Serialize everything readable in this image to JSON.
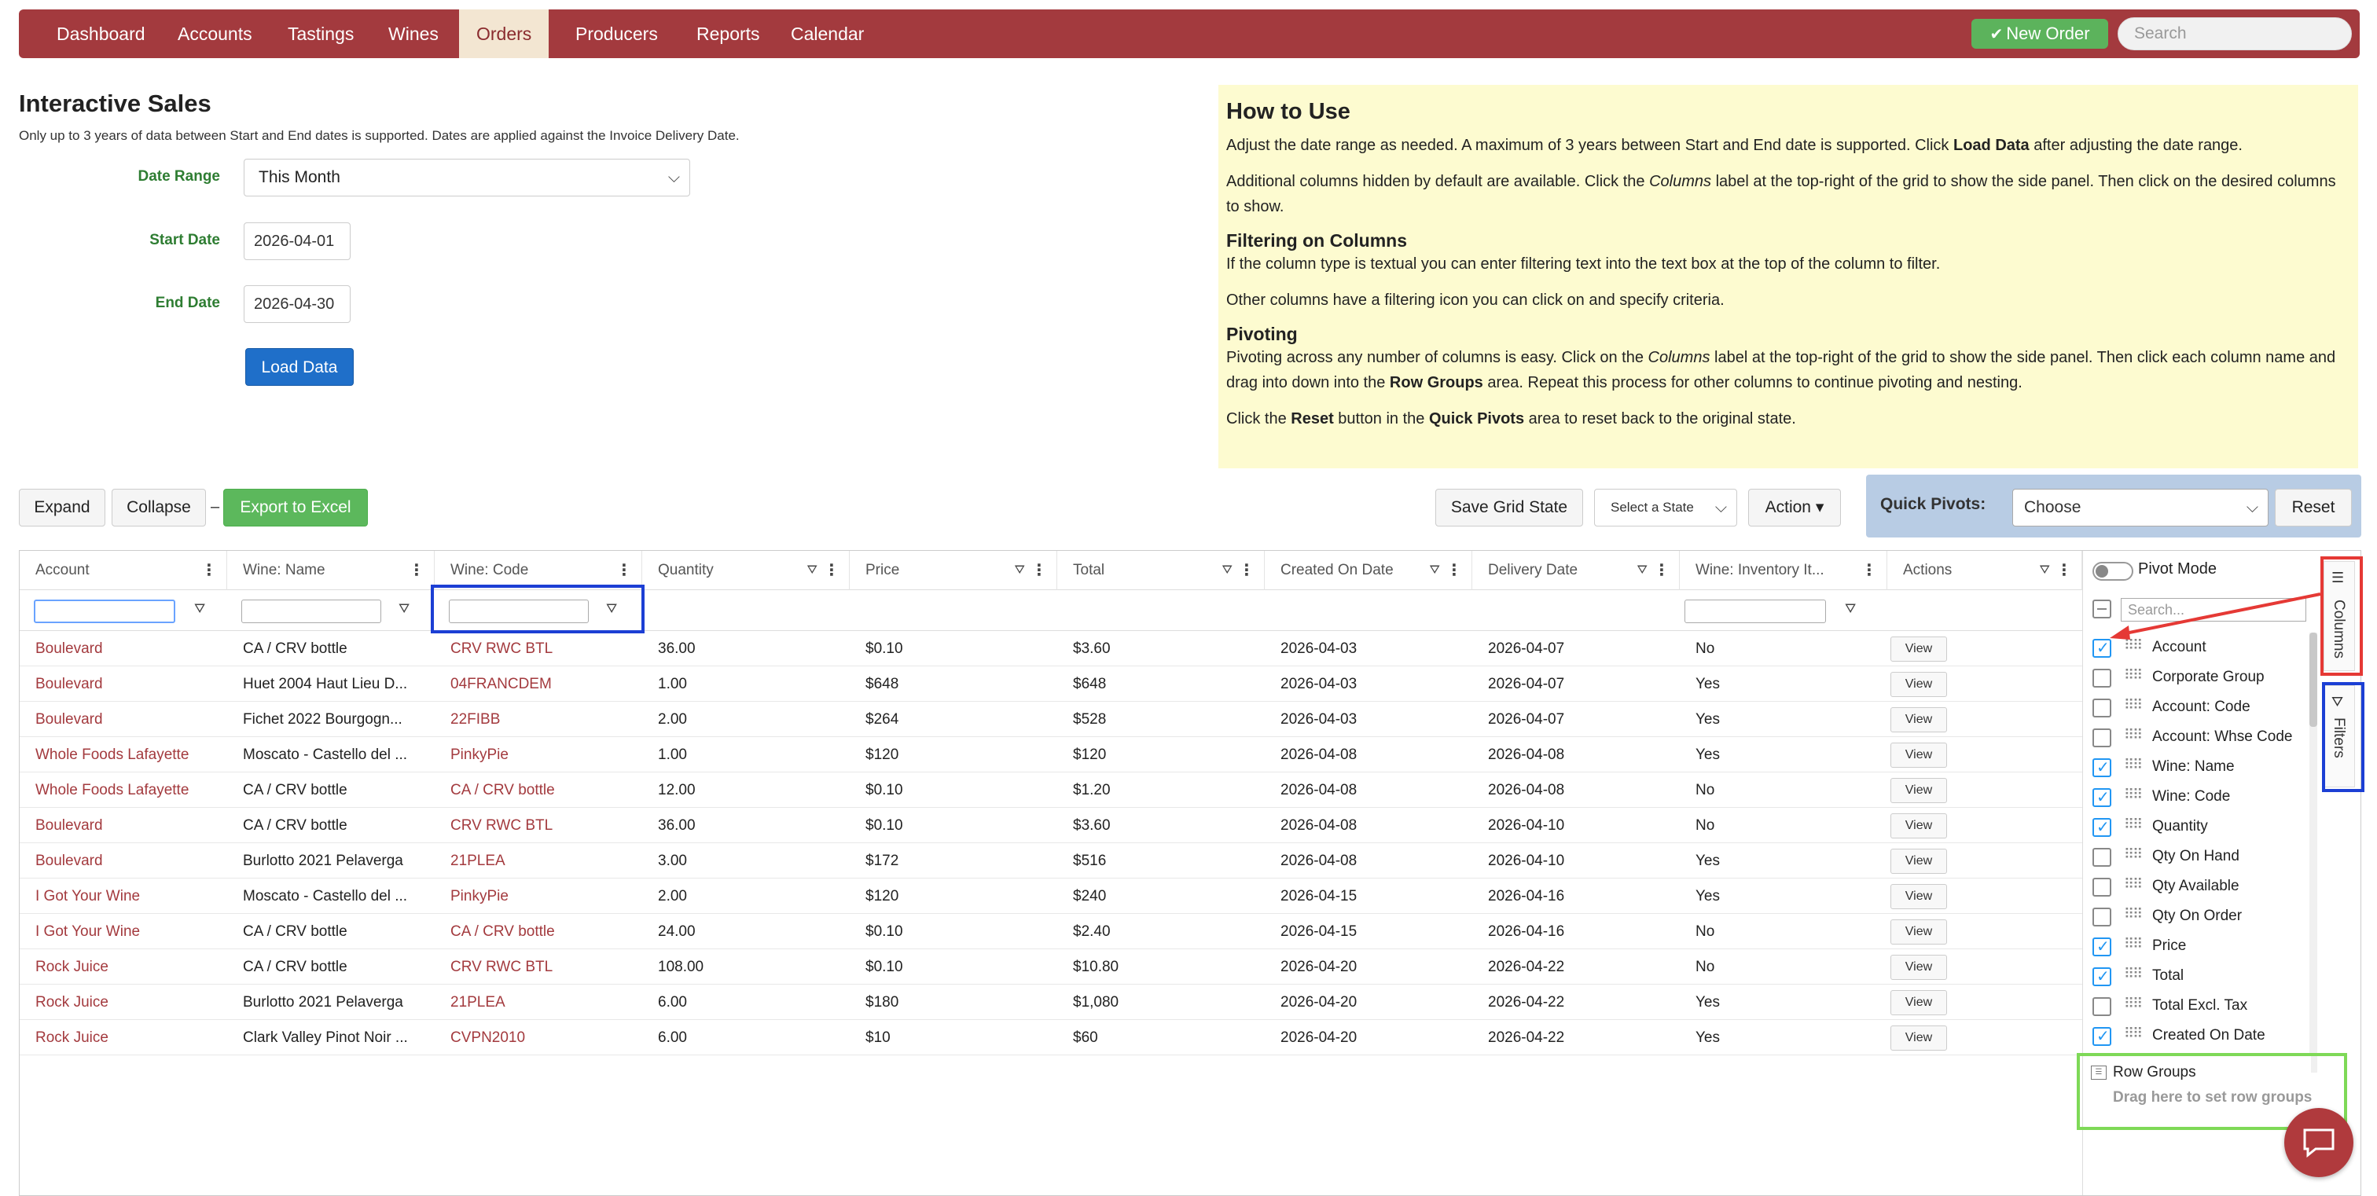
{
  "nav": {
    "items": [
      "Dashboard",
      "Accounts",
      "Tastings",
      "Wines",
      "Orders",
      "Producers",
      "Reports",
      "Calendar"
    ],
    "active": "Orders",
    "new_order": "New Order",
    "search_placeholder": "Search"
  },
  "page": {
    "title": "Interactive Sales",
    "subtitle": "Only up to 3 years of data between Start and End dates is supported. Dates are applied against the Invoice Delivery Date."
  },
  "form": {
    "date_range_label": "Date Range",
    "date_range_value": "This Month",
    "start_label": "Start Date",
    "start_value": "2026-04-01",
    "end_label": "End Date",
    "end_value": "2026-04-30",
    "load_button": "Load Data"
  },
  "help": {
    "title": "How to Use",
    "p1_a": "Adjust the date range as needed. A maximum of 3 years between Start and End date is supported. Click ",
    "p1_b": "Load Data",
    "p1_c": " after adjusting the date range.",
    "p2_a": "Additional columns hidden by default are available. Click the ",
    "p2_b": "Columns",
    "p2_c": " label at the top-right of the grid to show the side panel. Then click on the desired columns to show.",
    "filter_title": "Filtering on Columns",
    "p3": "If the column type is textual you can enter filtering text into the text box at the top of the column to filter.",
    "p4": "Other columns have a filtering icon you can click on and specify criteria.",
    "pivot_title": "Pivoting",
    "p5_a": "Pivoting across any number of columns is easy. Click on the ",
    "p5_b": "Columns",
    "p5_c": " label at the top-right of the grid to show the side panel. Then click each column name and drag into down into the ",
    "p5_d": "Row Groups",
    "p5_e": " area. Repeat this process for other columns to continue pivoting and nesting.",
    "p6_a": "Click the ",
    "p6_b": "Reset",
    "p6_c": " button in the ",
    "p6_d": "Quick Pivots",
    "p6_e": " area to reset back to the original state."
  },
  "toolbar": {
    "expand": "Expand",
    "collapse": "Collapse",
    "dash": "–",
    "export": "Export to Excel",
    "save_state": "Save Grid State",
    "select_state": "Select a State",
    "action": "Action ▾",
    "quick_pivots_label": "Quick Pivots:",
    "quick_pivots_value": "Choose",
    "reset": "Reset"
  },
  "grid": {
    "headers": [
      "Account",
      "Wine: Name",
      "Wine: Code",
      "Quantity",
      "Price",
      "Total",
      "Created On Date",
      "Delivery Date",
      "Wine: Inventory It...",
      "Actions"
    ],
    "view_label": "View",
    "rows": [
      [
        "Boulevard",
        "CA / CRV bottle",
        "CRV RWC BTL",
        "36.00",
        "$0.10",
        "$3.60",
        "2026-04-03",
        "2026-04-07",
        "No"
      ],
      [
        "Boulevard",
        "Huet 2004 Haut Lieu D...",
        "04FRANCDEM",
        "1.00",
        "$648",
        "$648",
        "2026-04-03",
        "2026-04-07",
        "Yes"
      ],
      [
        "Boulevard",
        "Fichet 2022 Bourgogn...",
        "22FIBB",
        "2.00",
        "$264",
        "$528",
        "2026-04-03",
        "2026-04-07",
        "Yes"
      ],
      [
        "Whole Foods Lafayette",
        "Moscato - Castello del ...",
        "PinkyPie",
        "1.00",
        "$120",
        "$120",
        "2026-04-08",
        "2026-04-08",
        "Yes"
      ],
      [
        "Whole Foods Lafayette",
        "CA / CRV bottle",
        "CA / CRV bottle",
        "12.00",
        "$0.10",
        "$1.20",
        "2026-04-08",
        "2026-04-08",
        "No"
      ],
      [
        "Boulevard",
        "CA / CRV bottle",
        "CRV RWC BTL",
        "36.00",
        "$0.10",
        "$3.60",
        "2026-04-08",
        "2026-04-10",
        "No"
      ],
      [
        "Boulevard",
        "Burlotto 2021 Pelaverga",
        "21PLEA",
        "3.00",
        "$172",
        "$516",
        "2026-04-08",
        "2026-04-10",
        "Yes"
      ],
      [
        "I Got Your Wine",
        "Moscato - Castello del ...",
        "PinkyPie",
        "2.00",
        "$120",
        "$240",
        "2026-04-15",
        "2026-04-16",
        "Yes"
      ],
      [
        "I Got Your Wine",
        "CA / CRV bottle",
        "CA / CRV bottle",
        "24.00",
        "$0.10",
        "$2.40",
        "2026-04-15",
        "2026-04-16",
        "No"
      ],
      [
        "Rock Juice",
        "CA / CRV bottle",
        "CRV RWC BTL",
        "108.00",
        "$0.10",
        "$10.80",
        "2026-04-20",
        "2026-04-22",
        "No"
      ],
      [
        "Rock Juice",
        "Burlotto 2021 Pelaverga",
        "21PLEA",
        "6.00",
        "$180",
        "$1,080",
        "2026-04-20",
        "2026-04-22",
        "Yes"
      ],
      [
        "Rock Juice",
        "Clark Valley Pinot Noir ...",
        "CVPN2010",
        "6.00",
        "$10",
        "$60",
        "2026-04-20",
        "2026-04-22",
        "Yes"
      ]
    ]
  },
  "side_panel": {
    "pivot_mode": "Pivot Mode",
    "search_placeholder": "Search...",
    "columns": [
      {
        "name": "Account",
        "checked": true
      },
      {
        "name": "Corporate Group",
        "checked": false
      },
      {
        "name": "Account: Code",
        "checked": false
      },
      {
        "name": "Account: Whse Code",
        "checked": false
      },
      {
        "name": "Wine: Name",
        "checked": true
      },
      {
        "name": "Wine: Code",
        "checked": true
      },
      {
        "name": "Quantity",
        "checked": true
      },
      {
        "name": "Qty On Hand",
        "checked": false
      },
      {
        "name": "Qty Available",
        "checked": false
      },
      {
        "name": "Qty On Order",
        "checked": false
      },
      {
        "name": "Price",
        "checked": true
      },
      {
        "name": "Total",
        "checked": true
      },
      {
        "name": "Total Excl. Tax",
        "checked": false
      },
      {
        "name": "Created On Date",
        "checked": true
      }
    ],
    "row_groups_title": "Row Groups",
    "row_groups_hint": "Drag here to set row groups",
    "tab_columns": "Columns",
    "tab_filters": "Filters"
  },
  "colors": {
    "brand": "#a33a3e",
    "link": "#a33a3e",
    "success": "#5cb85c",
    "primary": "#1f6fc9",
    "help_bg": "#fdfbd0",
    "quick_pivots_bg": "#b8cce4",
    "label_green": "#2e7d32"
  }
}
